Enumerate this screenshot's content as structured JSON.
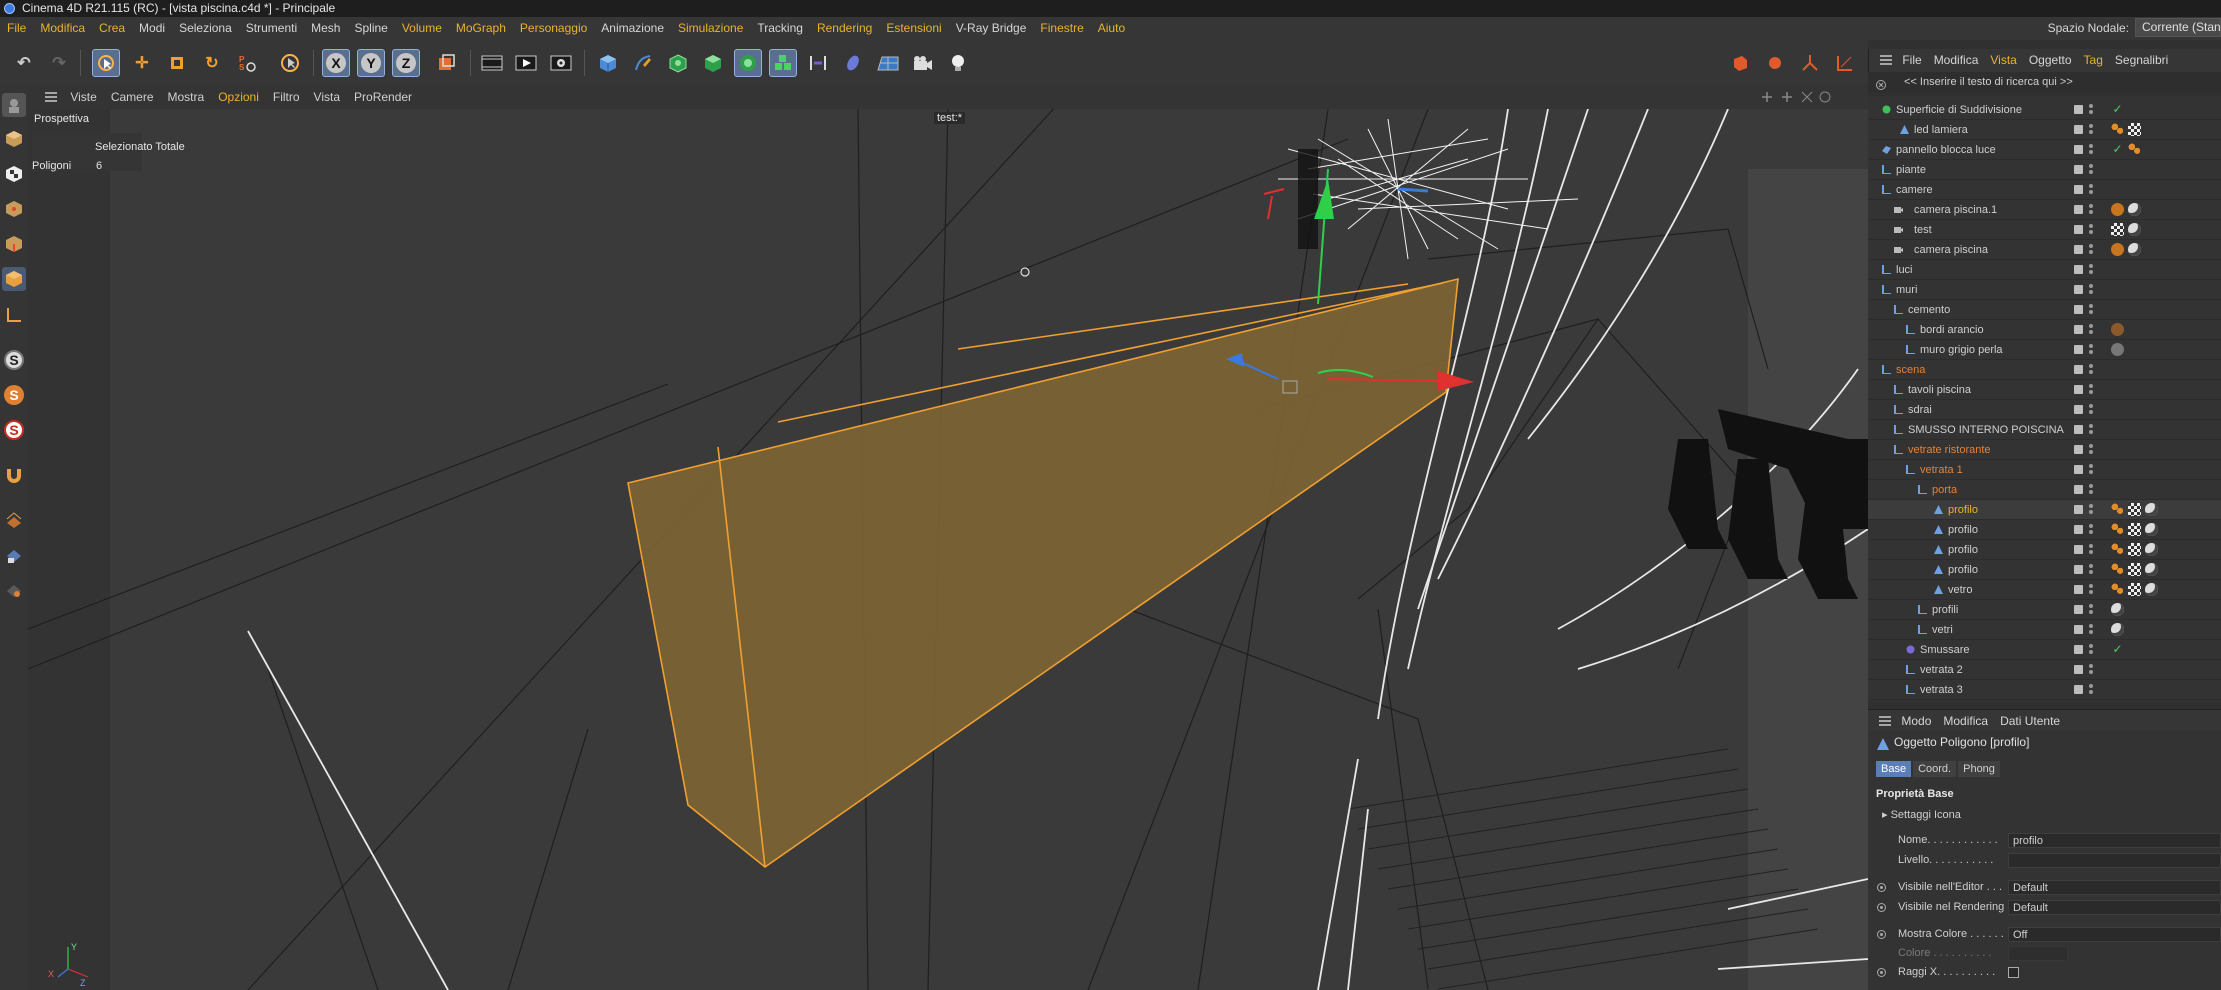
{
  "window": {
    "title": "Cinema 4D R21.115 (RC) - [vista piscina.c4d *] - Principale"
  },
  "menubar": {
    "items": [
      "File",
      "Modifica",
      "Crea",
      "Modi",
      "Seleziona",
      "Strumenti",
      "Mesh",
      "Spline",
      "Volume",
      "MoGraph",
      "Personaggio",
      "Animazione",
      "Simulazione",
      "Tracking",
      "Rendering",
      "Estensioni",
      "V-Ray Bridge",
      "Finestre",
      "Aiuto"
    ],
    "node_space_label": "Spazio Nodale:",
    "node_space_value": "Corrente (Standard)"
  },
  "toolbar": {
    "axis_x": "X",
    "axis_y": "Y",
    "axis_z": "Z"
  },
  "lefttoolbar": {
    "s_label": "S"
  },
  "viewport": {
    "menu": [
      "Viste",
      "Camere",
      "Mostra",
      "Opzioni",
      "Filtro",
      "Vista",
      "ProRender"
    ],
    "name": "Prospettiva",
    "hud_header": "Selezionato Totale",
    "hud_poly_label": "Poligoni",
    "hud_poly_value": "6",
    "camera_label": "test:*",
    "axis_y": "Y",
    "axis_x": "X",
    "axis_z": "Z"
  },
  "objectmanager": {
    "menu": [
      "File",
      "Modifica",
      "Vista",
      "Oggetto",
      "Tag",
      "Segnalibri"
    ],
    "search_placeholder": "<< Inserire il testo di ricerca qui >>",
    "rows": [
      {
        "name": "Superficie di Suddivisione"
      },
      {
        "name": "led lamiera"
      },
      {
        "name": "pannello blocca luce"
      },
      {
        "name": "piante"
      },
      {
        "name": "camere"
      },
      {
        "name": "camera piscina.1"
      },
      {
        "name": "test"
      },
      {
        "name": "camera piscina"
      },
      {
        "name": "luci"
      },
      {
        "name": "muri"
      },
      {
        "name": "cemento"
      },
      {
        "name": "bordi arancio"
      },
      {
        "name": "muro grigio perla"
      },
      {
        "name": "scena"
      },
      {
        "name": "tavoli piscina"
      },
      {
        "name": "sdrai"
      },
      {
        "name": "SMUSSO INTERNO POISCINA"
      },
      {
        "name": "vetrate ristorante"
      },
      {
        "name": "vetrata 1"
      },
      {
        "name": "porta"
      },
      {
        "name": "profilo"
      },
      {
        "name": "profilo"
      },
      {
        "name": "profilo"
      },
      {
        "name": "profilo"
      },
      {
        "name": "vetro"
      },
      {
        "name": "profili"
      },
      {
        "name": "vetri"
      },
      {
        "name": "Smussare"
      },
      {
        "name": "vetrata 2"
      },
      {
        "name": "vetrata 3"
      }
    ]
  },
  "attributes": {
    "menu": [
      "Modo",
      "Modifica",
      "Dati Utente"
    ],
    "object_title": "Oggetto Poligono [profilo]",
    "tabs": [
      "Base",
      "Coord.",
      "Phong"
    ],
    "section": "Proprietà Base",
    "subsection": "Settaggi Icona",
    "fields": [
      {
        "label": "Nome. . . . . . . . . . . .",
        "value": "profilo"
      },
      {
        "label": "Livello. . . . . . . . . . .",
        "value": ""
      },
      {
        "label": "Visibile nell'Editor . . .",
        "value": "Default"
      },
      {
        "label": "Visibile nel Rendering",
        "value": "Default"
      },
      {
        "label": "Mostra Colore . . . . . .",
        "value": "Off"
      },
      {
        "label": "Colore . . . . . . . . . .",
        "value": ""
      },
      {
        "label": "Raggi X. . . . . . . . . .",
        "value": ""
      }
    ]
  },
  "colors": {
    "accent": "#e8b42b",
    "selection": "#7a6233",
    "edge": "#f0a030",
    "bg": "#3a3a3a"
  }
}
